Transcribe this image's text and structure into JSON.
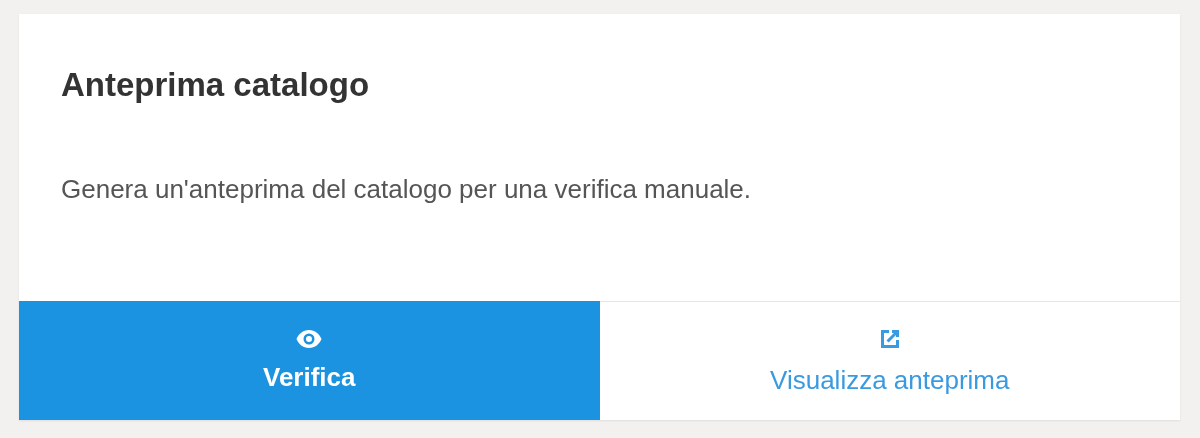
{
  "card": {
    "title": "Anteprima catalogo",
    "description": "Genera un'anteprima del catalogo per una verifica manuale.",
    "actions": [
      {
        "label": "Verifica",
        "kind": "primary"
      },
      {
        "label": "Visualizza anteprima",
        "kind": "secondary"
      }
    ]
  }
}
